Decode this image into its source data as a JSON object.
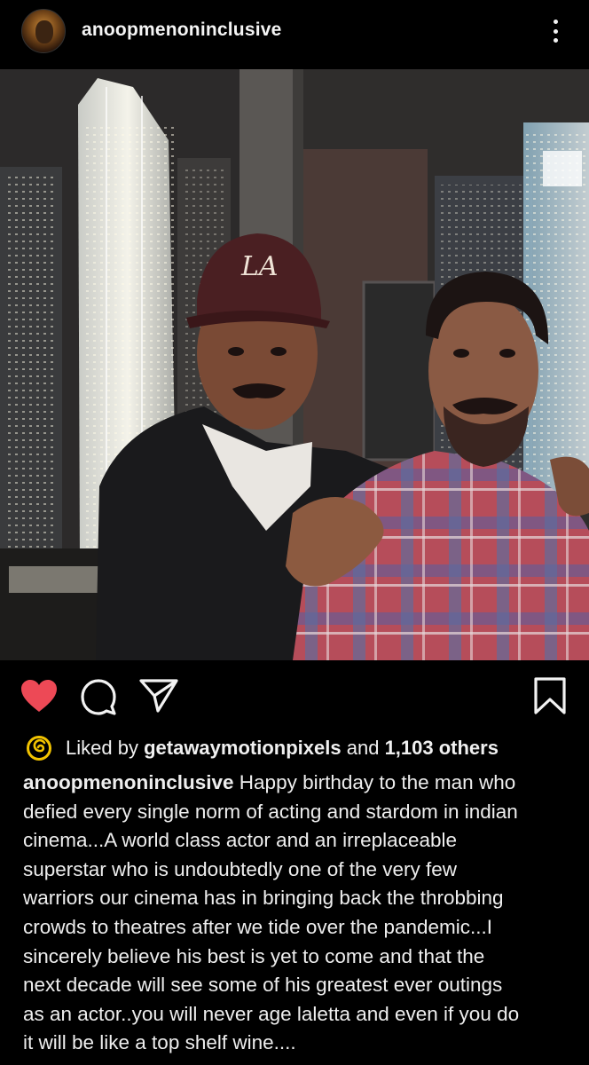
{
  "header": {
    "username": "anoopmenoninclusive",
    "avatar_icon": "profile-avatar",
    "more_icon": "more-vertical-icon"
  },
  "post": {
    "image_icon": "post-photo"
  },
  "actions": {
    "like_icon": "heart-filled-icon",
    "like_color": "#ed4956",
    "comment_icon": "comment-icon",
    "share_icon": "send-icon",
    "save_icon": "bookmark-icon"
  },
  "likes": {
    "prefix": "Liked by",
    "user": "getawaymotionpixels",
    "connector": "and",
    "others": "1,103 others",
    "badge_icon": "spiral-icon",
    "badge_color": "#f2c300"
  },
  "caption": {
    "author": "anoopmenoninclusive",
    "lines": [
      " Happy birthday to the man who",
      "defied every single norm of acting and stardom in indian",
      "cinema...A world class actor and an irreplaceable",
      "superstar who is undoubtedly one of the very few",
      "warriors our cinema has in bringing back the throbbing",
      "crowds to theatres after we tide over the pandemic...I",
      "sincerely believe his best is yet to come and that the",
      "next decade will see some of his greatest ever outings",
      "as an actor..you will never age laletta and even if you do",
      "it will be like a top shelf wine...."
    ]
  }
}
